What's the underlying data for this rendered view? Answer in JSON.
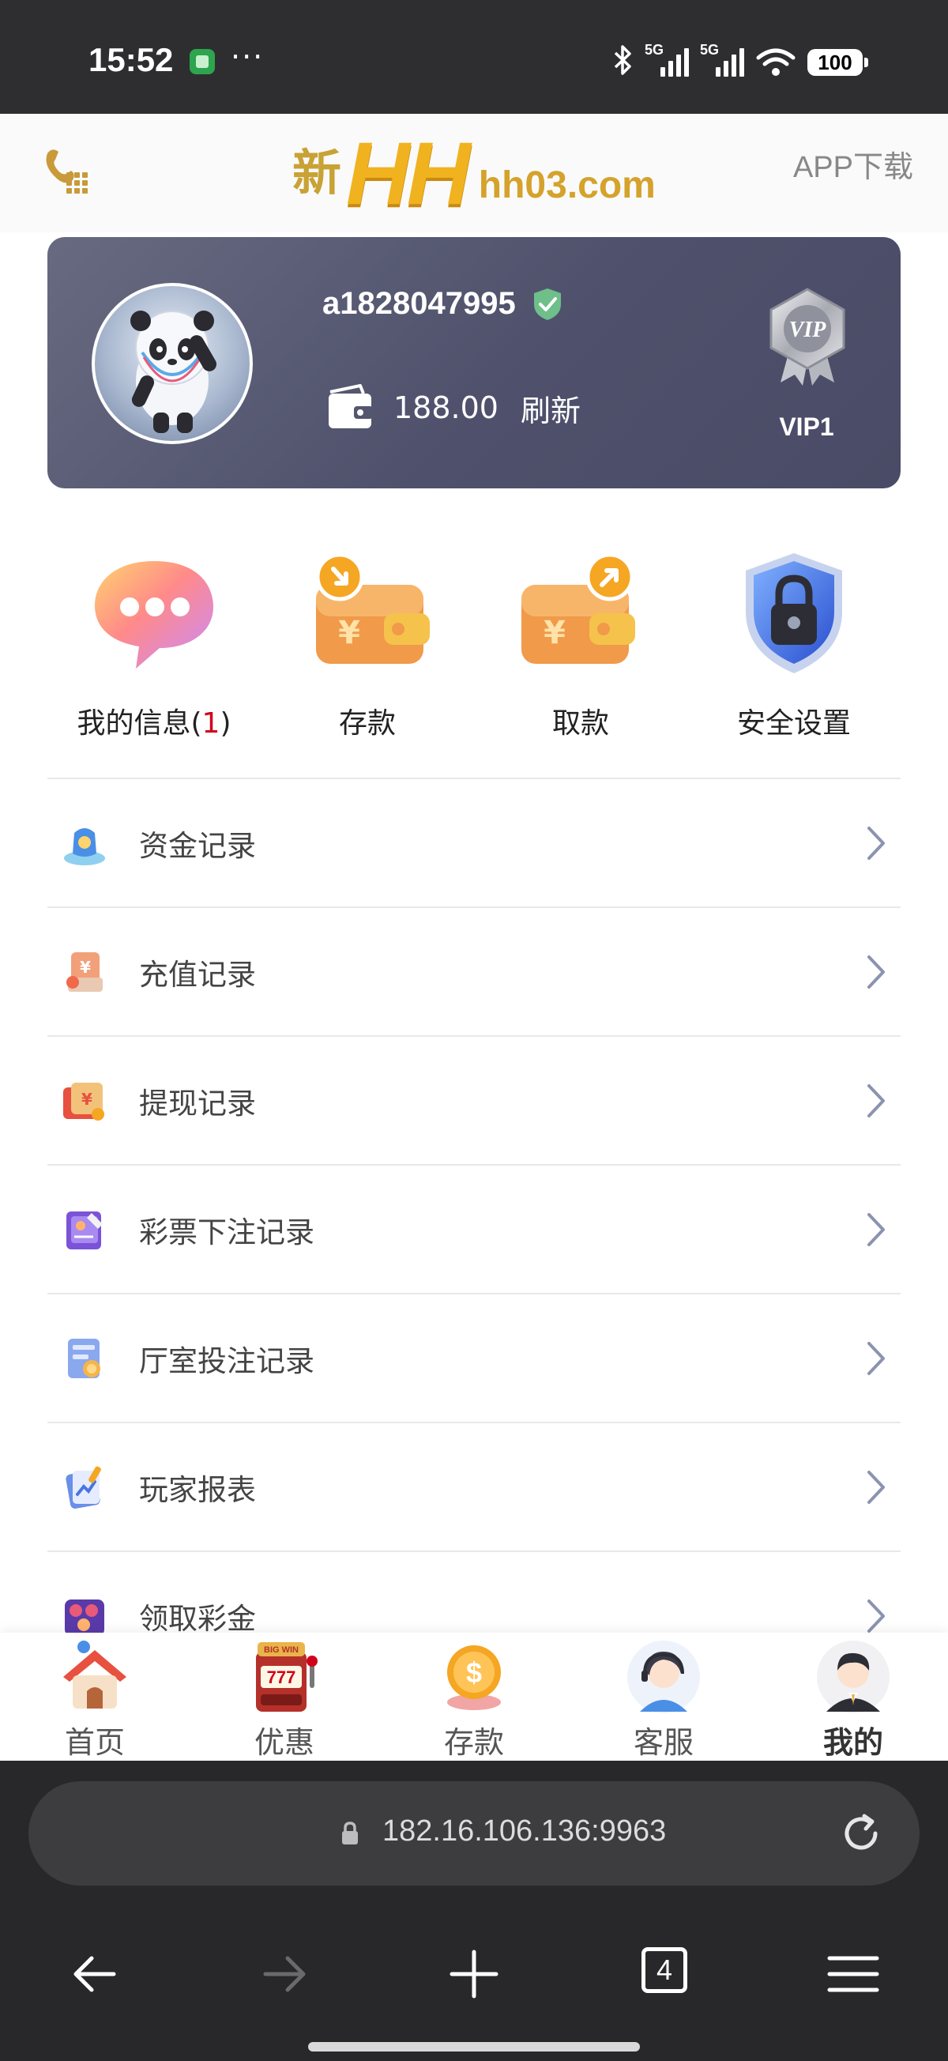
{
  "status_bar": {
    "time": "15:52",
    "dots": "···",
    "signal_1": "5G",
    "signal_2": "5G",
    "battery": "100"
  },
  "header": {
    "logo_prefix": "新",
    "logo_main": "HH",
    "logo_domain": "hh03.com",
    "app_download": "APP下载",
    "phone_icon": "phone-keypad-icon"
  },
  "user": {
    "username": "a1828047995",
    "verified_icon": "shield-check-icon",
    "balance": "188.00",
    "refresh": "刷新",
    "vip_badge_text": "VIP",
    "vip_level": "VIP1"
  },
  "actions": [
    {
      "label": "我的信息",
      "count": "1",
      "icon": "chat-bubble-icon"
    },
    {
      "label": "存款",
      "icon": "wallet-deposit-icon"
    },
    {
      "label": "取款",
      "icon": "wallet-withdraw-icon"
    },
    {
      "label": "安全设置",
      "icon": "lock-shield-icon"
    }
  ],
  "menu": [
    {
      "label": "资金记录",
      "icon": "fund-record-icon"
    },
    {
      "label": "充值记录",
      "icon": "recharge-record-icon"
    },
    {
      "label": "提现记录",
      "icon": "withdraw-record-icon"
    },
    {
      "label": "彩票下注记录",
      "icon": "lottery-bet-icon"
    },
    {
      "label": "厅室投注记录",
      "icon": "hall-bet-icon"
    },
    {
      "label": "玩家报表",
      "icon": "player-report-icon"
    },
    {
      "label": "领取彩金",
      "icon": "claim-bonus-icon"
    }
  ],
  "tabbar": [
    {
      "label": "首页",
      "icon": "home-icon"
    },
    {
      "label": "优惠",
      "icon": "slot-machine-icon"
    },
    {
      "label": "存款",
      "icon": "coin-icon"
    },
    {
      "label": "客服",
      "icon": "support-agent-icon"
    },
    {
      "label": "我的",
      "icon": "profile-icon",
      "active": true
    }
  ],
  "browser": {
    "url": "182.16.106.136:9963",
    "tab_count": "4"
  },
  "colors": {
    "card": "#545670",
    "accent_gold": "#f0b21f",
    "chevron": "#8c93b0",
    "count_red": "#d0021b"
  }
}
